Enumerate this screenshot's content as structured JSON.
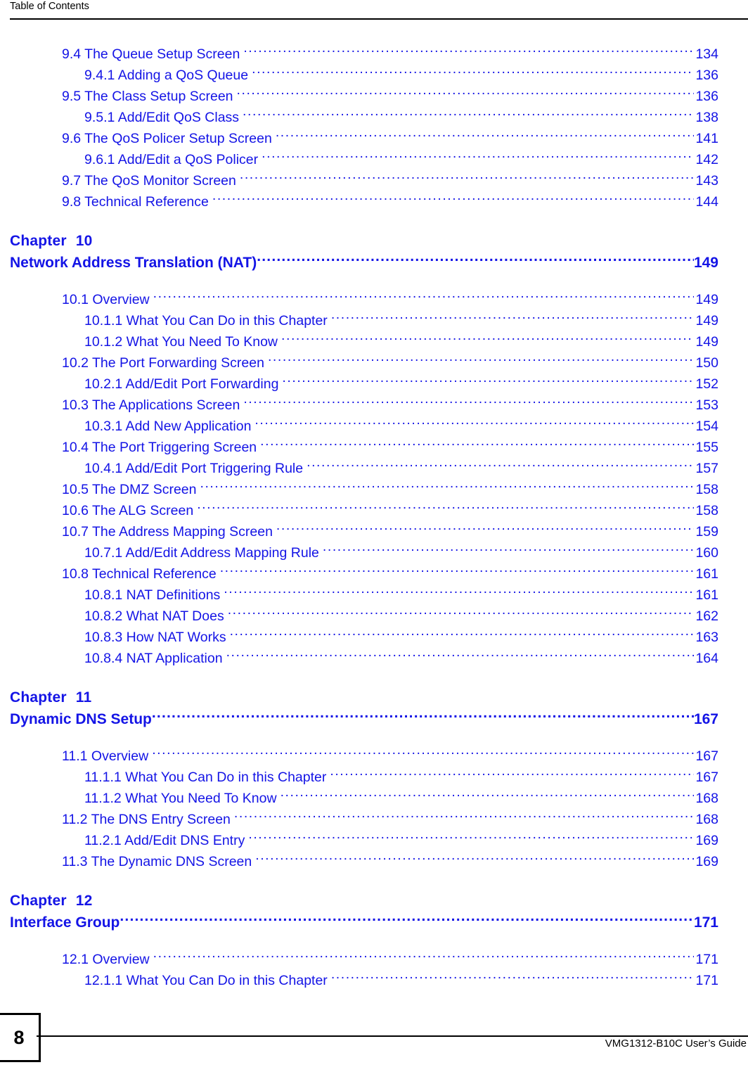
{
  "header": {
    "title": "Table of Contents"
  },
  "footer": {
    "page_number": "8",
    "guide_title": "VMG1312-B10C User’s Guide"
  },
  "colors": {
    "link_blue": "#1414e6",
    "text_black": "#000000",
    "page_background": "#ffffff"
  },
  "toc": {
    "blocks": [
      {
        "type": "entries",
        "entries": [
          {
            "level": 2,
            "title": "9.4 The Queue Setup Screen",
            "page": "134"
          },
          {
            "level": 3,
            "title": "9.4.1 Adding a QoS Queue",
            "page": "136"
          },
          {
            "level": 2,
            "title": "9.5 The Class Setup Screen",
            "page": "136"
          },
          {
            "level": 3,
            "title": "9.5.1 Add/Edit QoS Class",
            "page": "138"
          },
          {
            "level": 2,
            "title": "9.6 The QoS Policer Setup Screen",
            "page": "141"
          },
          {
            "level": 3,
            "title": "9.6.1 Add/Edit a QoS Policer",
            "page": "142"
          },
          {
            "level": 2,
            "title": "9.7 The QoS Monitor Screen",
            "page": "143"
          },
          {
            "level": 2,
            "title": "9.8 Technical Reference",
            "page": "144"
          }
        ]
      },
      {
        "type": "chapter",
        "chapter_word": "Chapter",
        "chapter_number": "10",
        "title": "Network Address Translation (NAT)",
        "page": "149"
      },
      {
        "type": "entries",
        "entries": [
          {
            "level": 2,
            "title": "10.1 Overview",
            "page": "149"
          },
          {
            "level": 3,
            "title": "10.1.1 What You Can Do in this Chapter",
            "page": "149"
          },
          {
            "level": 3,
            "title": "10.1.2 What You Need To Know",
            "page": "149"
          },
          {
            "level": 2,
            "title": "10.2 The Port Forwarding Screen",
            "page": "150"
          },
          {
            "level": 3,
            "title": "10.2.1 Add/Edit Port Forwarding",
            "page": "152"
          },
          {
            "level": 2,
            "title": "10.3 The Applications Screen",
            "page": "153"
          },
          {
            "level": 3,
            "title": "10.3.1 Add New Application",
            "page": "154"
          },
          {
            "level": 2,
            "title": "10.4 The Port Triggering Screen",
            "page": "155"
          },
          {
            "level": 3,
            "title": "10.4.1 Add/Edit Port Triggering Rule",
            "page": "157"
          },
          {
            "level": 2,
            "title": "10.5 The DMZ Screen",
            "page": "158"
          },
          {
            "level": 2,
            "title": "10.6 The ALG Screen",
            "page": "158"
          },
          {
            "level": 2,
            "title": "10.7 The Address Mapping Screen",
            "page": "159"
          },
          {
            "level": 3,
            "title": "10.7.1 Add/Edit Address Mapping Rule",
            "page": "160"
          },
          {
            "level": 2,
            "title": "10.8 Technical Reference",
            "page": "161"
          },
          {
            "level": 3,
            "title": "10.8.1 NAT Definitions",
            "page": "161"
          },
          {
            "level": 3,
            "title": "10.8.2 What NAT Does",
            "page": "162"
          },
          {
            "level": 3,
            "title": "10.8.3 How NAT Works",
            "page": "163"
          },
          {
            "level": 3,
            "title": "10.8.4 NAT Application",
            "page": "164"
          }
        ]
      },
      {
        "type": "chapter",
        "chapter_word": "Chapter",
        "chapter_number": "11",
        "title": "Dynamic DNS Setup",
        "page": "167"
      },
      {
        "type": "entries",
        "entries": [
          {
            "level": 2,
            "title": "11.1 Overview",
            "page": "167"
          },
          {
            "level": 3,
            "title": "11.1.1 What You Can Do in this Chapter",
            "page": "167"
          },
          {
            "level": 3,
            "title": "11.1.2 What You Need To Know",
            "page": "168"
          },
          {
            "level": 2,
            "title": "11.2 The DNS Entry Screen",
            "page": "168"
          },
          {
            "level": 3,
            "title": "11.2.1 Add/Edit DNS Entry",
            "page": "169"
          },
          {
            "level": 2,
            "title": "11.3 The Dynamic DNS Screen",
            "page": "169"
          }
        ]
      },
      {
        "type": "chapter",
        "chapter_word": "Chapter",
        "chapter_number": "12",
        "title": "Interface Group",
        "page": "171"
      },
      {
        "type": "entries",
        "entries": [
          {
            "level": 2,
            "title": "12.1 Overview",
            "page": "171"
          },
          {
            "level": 3,
            "title": "12.1.1 What You Can Do in this Chapter",
            "page": "171"
          }
        ]
      }
    ]
  }
}
